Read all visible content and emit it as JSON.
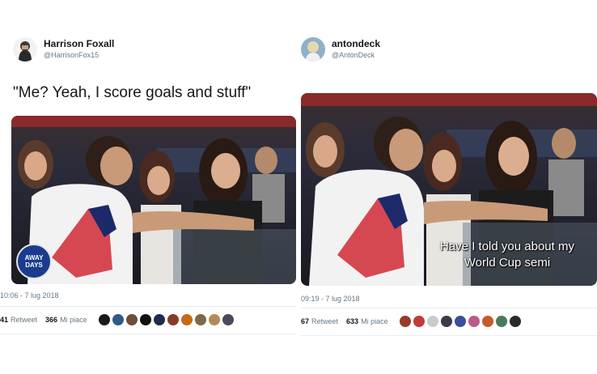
{
  "left_tweet": {
    "display_name": "Harrison Foxall",
    "handle": "@HarrisonFox15",
    "text": "\"Me? Yeah, I score goals and stuff\"",
    "watermark": "AWAY DAYS",
    "timestamp": "10:06 - 7 lug 2018",
    "retweets_count": "41",
    "retweets_label": "Retweet",
    "likes_count": "366",
    "likes_label": "Mi piace",
    "liker_colors": [
      "#1a1a1a",
      "#2b5b8a",
      "#6b4f3a",
      "#111111",
      "#1e2d4a",
      "#8a3a2a",
      "#c46a1a",
      "#7a6a4a",
      "#b58a5a",
      "#4a4a5a"
    ]
  },
  "right_tweet": {
    "display_name": "antondeck",
    "handle": "@AntonDeck",
    "caption_line1": "Have I told you about my",
    "caption_line2": "World Cup semi",
    "timestamp": "09:19 - 7 lug 2018",
    "retweets_count": "67",
    "retweets_label": "Retweet",
    "likes_count": "633",
    "likes_label": "Mi piace",
    "liker_colors": [
      "#9a3a2a",
      "#c23a3a",
      "#c8ccd0",
      "#3a3a4a",
      "#3b4ea0",
      "#b85a8a",
      "#c85a2a",
      "#4a7a5a",
      "#2a2a2a"
    ]
  }
}
